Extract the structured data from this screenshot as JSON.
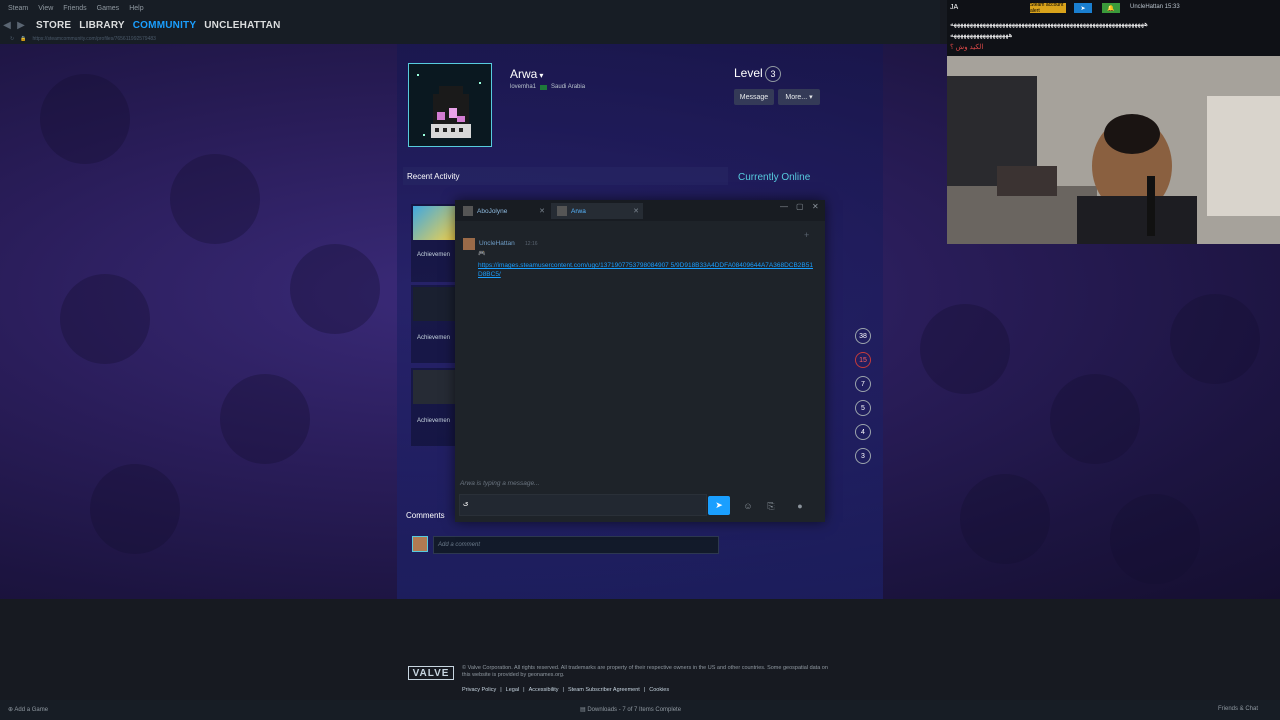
{
  "menu": [
    "Steam",
    "View",
    "Friends",
    "Games",
    "Help"
  ],
  "nav": {
    "store": "STORE",
    "library": "LIBRARY",
    "community": "COMMUNITY",
    "user": "UNCLEHATTAN",
    "url": "https://steamcommunity.com/profiles/765611992579483"
  },
  "profile": {
    "name": "Arwa",
    "realname": "lovemha1",
    "country": "Saudi Arabia",
    "level_label": "Level",
    "level": "3",
    "message_btn": "Message",
    "more_btn": "More...",
    "recent_activity": "Recent Activity",
    "status": "Currently Online",
    "achievement_label": "Achievemen",
    "counters": [
      "38",
      "15",
      "7",
      "5",
      "4",
      "3"
    ],
    "comments_label": "Comments",
    "comment_placeholder": "Add a comment"
  },
  "chat": {
    "tabs": [
      {
        "label": "AboJolyne"
      },
      {
        "label": "Arwa"
      }
    ],
    "message_author": "UncleHattan",
    "message_time": "12:16",
    "message_emoji": "🎮",
    "message_link": "https://images.steamusercontent.com/ugc/1371907753798084907 5/9D918B33A4DDFA08409644A7A368DCB2B51D8BC5/",
    "typing": "Arwa is typing a message...",
    "input_value": "ى"
  },
  "stream": {
    "title": "JA",
    "alert": "Steam account alert",
    "user": "UncleHattan",
    "time": "15:33",
    "line1": "ههههههههههههههههههههههههههههههههههههههههههههههههههههههههههههه",
    "line2": "ههههههههههههههههههه",
    "line3": "الكيد وش ؟"
  },
  "footer": {
    "logo": "VALVE",
    "copy": "© Valve Corporation. All rights reserved. All trademarks are property of their respective owners in the US and other countries. Some geospatial data on this website is provided by geonames.org.",
    "links": [
      "Privacy Policy",
      "|",
      "Legal",
      "|",
      "Accessibility",
      "|",
      "Steam Subscriber Agreement",
      "|",
      "Cookies"
    ]
  },
  "bottom": {
    "add_game": "Add a Game",
    "downloads": "Downloads - 7 of 7 Items Complete",
    "friends": "Friends & Chat"
  },
  "colors": {
    "accent": "#1a9fff",
    "online": "#57cbde",
    "background": "#171a21"
  }
}
